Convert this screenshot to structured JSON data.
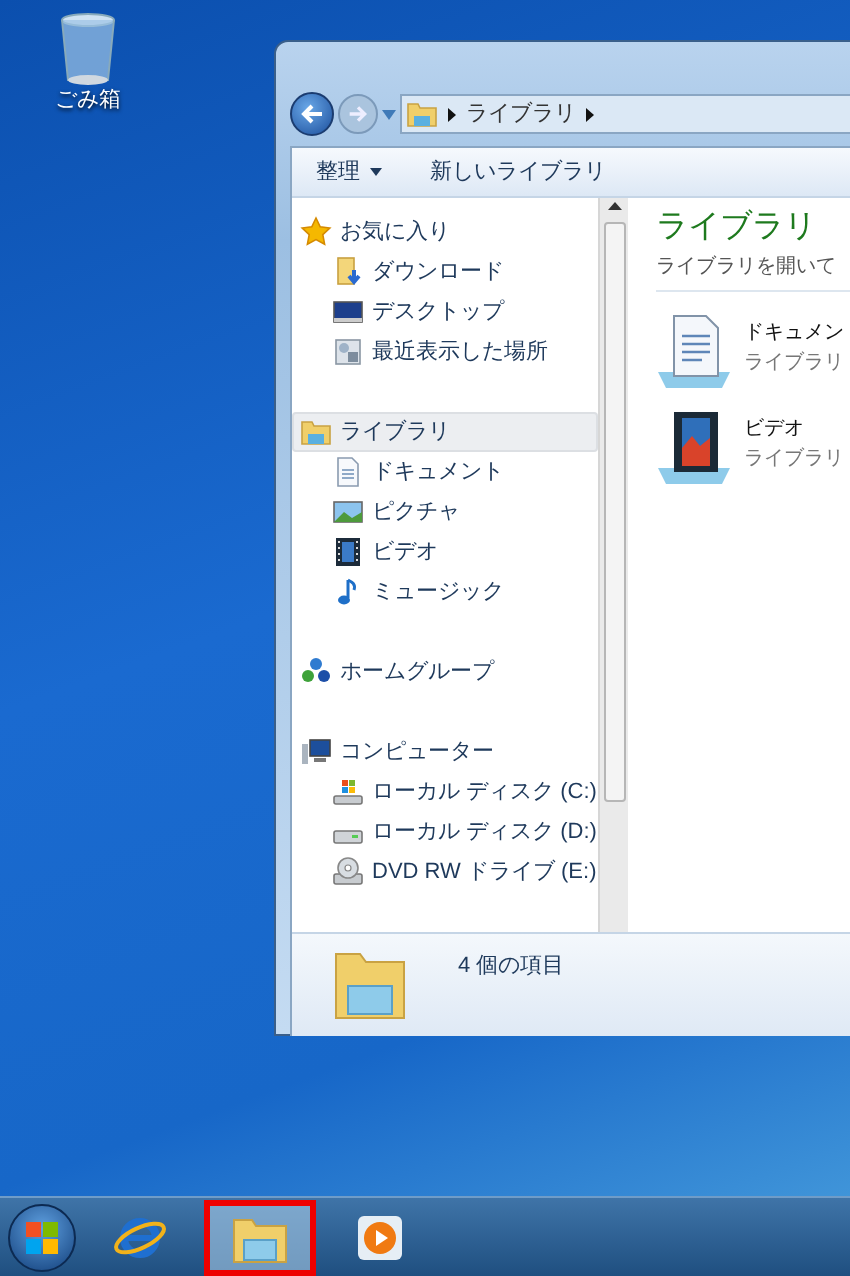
{
  "desktop_icons": [
    {
      "label": "ごみ箱"
    }
  ],
  "window": {
    "address": {
      "crumbs": [
        "ライブラリ"
      ]
    },
    "toolbar": [
      {
        "label": "整理",
        "dropdown": true
      },
      {
        "label": "新しいライブラリ",
        "dropdown": false
      }
    ],
    "nav": [
      {
        "label": "お気に入り",
        "kind": "star",
        "selected": false,
        "children": [
          {
            "label": "ダウンロード",
            "kind": "download"
          },
          {
            "label": "デスクトップ",
            "kind": "desktop"
          },
          {
            "label": "最近表示した場所",
            "kind": "recent"
          }
        ]
      },
      {
        "label": "ライブラリ",
        "kind": "library",
        "selected": true,
        "children": [
          {
            "label": "ドキュメント",
            "kind": "document"
          },
          {
            "label": "ピクチャ",
            "kind": "picture"
          },
          {
            "label": "ビデオ",
            "kind": "video"
          },
          {
            "label": "ミュージック",
            "kind": "music"
          }
        ]
      },
      {
        "label": "ホームグループ",
        "kind": "homegroup",
        "selected": false
      },
      {
        "label": "コンピューター",
        "kind": "computer",
        "selected": false,
        "children": [
          {
            "label": "ローカル ディスク (C:)",
            "kind": "drive-os"
          },
          {
            "label": "ローカル ディスク (D:)",
            "kind": "drive"
          },
          {
            "label": "DVD RW ドライブ (E:)",
            "kind": "dvd"
          }
        ]
      }
    ],
    "content": {
      "title": "ライブラリ",
      "subtitle": "ライブラリを開いて",
      "items": [
        {
          "name": "ドキュメン",
          "detail": "ライブラリ",
          "kind": "document"
        },
        {
          "name": "ビデオ",
          "detail": "ライブラリ",
          "kind": "video"
        }
      ]
    },
    "status": {
      "text": "4 個の項目"
    }
  },
  "taskbar": {
    "items": [
      {
        "kind": "ie",
        "selected": false
      },
      {
        "kind": "explorer",
        "selected": true
      },
      {
        "kind": "media",
        "selected": false
      }
    ]
  }
}
